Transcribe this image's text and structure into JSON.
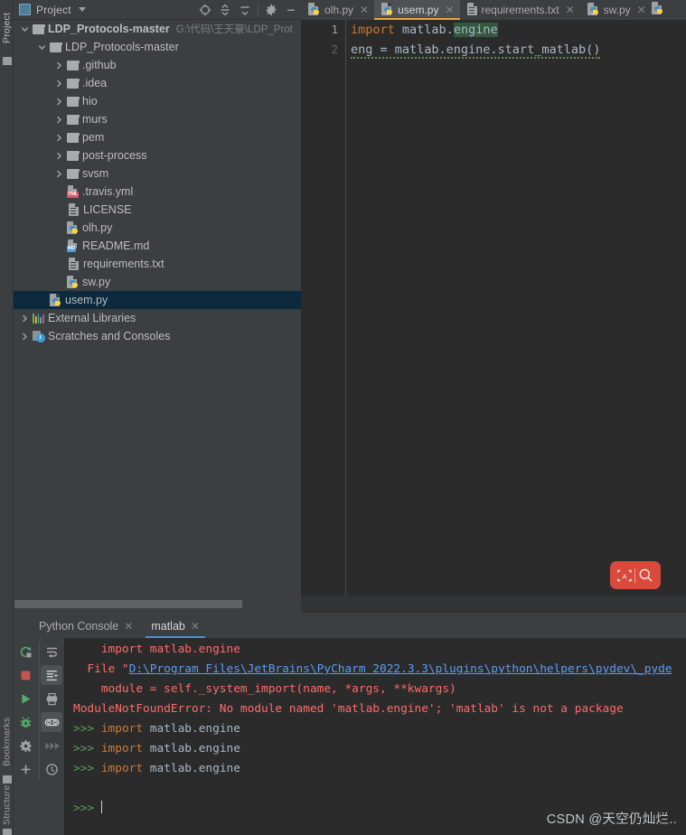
{
  "vertical_strip": {
    "labels": [
      {
        "name": "project",
        "text": "Project"
      },
      {
        "name": "bookmarks",
        "text": "Bookmarks"
      },
      {
        "name": "structure",
        "text": "Structure"
      }
    ]
  },
  "project_panel": {
    "title": "Project",
    "toolbar_icons": [
      "locate-icon",
      "expand-all-icon",
      "collapse-all-icon",
      "gear-icon",
      "minimize-icon"
    ],
    "tree": [
      {
        "name": "ldp-protocols-master-root",
        "label": "LDP_Protocols-master",
        "bold_prefix": "LDP_Protocols",
        "bold_suffix": "-master",
        "path": "G:\\代码\\王天豪\\LDP_Prot",
        "icon": "folder-icon",
        "depth": 0,
        "state": "expanded",
        "selected": false
      },
      {
        "name": "ldp-protocols-master-inner",
        "label": "LDP_Protocols-master",
        "icon": "folder-icon",
        "depth": 1,
        "state": "expanded",
        "selected": false
      },
      {
        "name": "github-folder",
        "label": ".github",
        "icon": "folder-icon",
        "depth": 2,
        "state": "collapsed",
        "selected": false
      },
      {
        "name": "idea-folder",
        "label": ".idea",
        "icon": "folder-icon",
        "depth": 2,
        "state": "collapsed",
        "selected": false
      },
      {
        "name": "hio-folder",
        "label": "hio",
        "icon": "folder-icon",
        "depth": 2,
        "state": "collapsed",
        "selected": false
      },
      {
        "name": "murs-folder",
        "label": "murs",
        "icon": "folder-icon",
        "depth": 2,
        "state": "collapsed",
        "selected": false
      },
      {
        "name": "pem-folder",
        "label": "pem",
        "icon": "folder-icon",
        "depth": 2,
        "state": "collapsed",
        "selected": false
      },
      {
        "name": "post-process-folder",
        "label": "post-process",
        "icon": "folder-icon",
        "depth": 2,
        "state": "collapsed",
        "selected": false
      },
      {
        "name": "svsm-folder",
        "label": "svsm",
        "icon": "folder-icon",
        "depth": 2,
        "state": "collapsed",
        "selected": false
      },
      {
        "name": "travis-yml-file",
        "label": ".travis.yml",
        "icon": "yaml-file-icon",
        "badge": "YML",
        "depth": 2,
        "state": "leaf",
        "selected": false
      },
      {
        "name": "license-file",
        "label": "LICENSE",
        "icon": "text-file-icon",
        "depth": 2,
        "state": "leaf",
        "selected": false
      },
      {
        "name": "olh-py-file",
        "label": "olh.py",
        "icon": "python-file-icon",
        "depth": 2,
        "state": "leaf",
        "selected": false
      },
      {
        "name": "readme-md-file",
        "label": "README.md",
        "icon": "markdown-file-icon",
        "badge": "MD",
        "depth": 2,
        "state": "leaf",
        "selected": false
      },
      {
        "name": "requirements-txt-file",
        "label": "requirements.txt",
        "icon": "text-file-icon",
        "depth": 2,
        "state": "leaf",
        "selected": false
      },
      {
        "name": "sw-py-file",
        "label": "sw.py",
        "icon": "python-file-icon",
        "depth": 2,
        "state": "leaf",
        "selected": false
      },
      {
        "name": "usem-py-file",
        "label": "usem.py",
        "icon": "python-file-icon",
        "depth": 1,
        "state": "leaf",
        "selected": true
      },
      {
        "name": "external-libraries",
        "label": "External Libraries",
        "icon": "libraries-icon",
        "depth": 0,
        "state": "collapsed",
        "selected": false
      },
      {
        "name": "scratches-and-consoles",
        "label": "Scratches and Consoles",
        "icon": "scratches-icon",
        "depth": 0,
        "state": "collapsed",
        "selected": false
      }
    ]
  },
  "editor": {
    "tabs": [
      {
        "name": "tab-olh-py",
        "label": "olh.py",
        "icon": "python-file-icon",
        "active": false
      },
      {
        "name": "tab-usem-py",
        "label": "usem.py",
        "icon": "python-file-icon",
        "active": true
      },
      {
        "name": "tab-requirements-txt",
        "label": "requirements.txt",
        "icon": "text-file-icon",
        "active": false
      },
      {
        "name": "tab-sw-py",
        "label": "sw.py",
        "icon": "python-file-icon",
        "active": false
      }
    ],
    "close_glyph": "✕",
    "line_numbers": [
      "1",
      "2"
    ],
    "code_lines": [
      {
        "number": "1",
        "keyword": "import",
        "plain": " matlab.",
        "highlight": "engine"
      },
      {
        "number": "2",
        "plain_full": "eng = matlab.engine.start_matlab()"
      }
    ],
    "ai_widget": {
      "name": "ai-search-widget",
      "ai_label": "A",
      "color": "#d94a3d"
    }
  },
  "console": {
    "tabs": [
      {
        "name": "console-tab-python-console",
        "label": "Python Console",
        "active": false
      },
      {
        "name": "console-tab-matlab",
        "label": "matlab",
        "active": true
      }
    ],
    "close_glyph": "✕",
    "toolbar_left": [
      "rerun-icon",
      "stop-icon",
      "run-icon",
      "debug-icon",
      "settings-icon",
      "add-icon"
    ],
    "toolbar_right": [
      "soft-wrap-icon",
      "scroll-to-end-icon",
      "print-icon",
      "use-soft-wraps-icon",
      "fast-forward-icon",
      "history-icon"
    ],
    "output": [
      {
        "kind": "err",
        "text": "    import matlab.engine"
      },
      {
        "kind": "err_link",
        "prefix": "  File \"",
        "link": "D:\\Program Files\\JetBrains\\PyCharm 2022.3.3\\plugins\\python\\helpers\\pydev\\_pyde"
      },
      {
        "kind": "err",
        "text": "    module = self._system_import(name, *args, **kwargs)"
      },
      {
        "kind": "err",
        "text": "ModuleNotFoundError: No module named 'matlab.engine'; 'matlab' is not a package"
      },
      {
        "kind": "prompt",
        "prompt": ">>>",
        "keyword": "import",
        "rest": " matlab.engine"
      },
      {
        "kind": "prompt",
        "prompt": ">>>",
        "keyword": "import",
        "rest": " matlab.engine"
      },
      {
        "kind": "prompt",
        "prompt": ">>>",
        "keyword": "import",
        "rest": " matlab.engine"
      },
      {
        "kind": "blank",
        "text": ""
      },
      {
        "kind": "prompt_empty",
        "prompt": ">>>"
      }
    ]
  },
  "watermark": {
    "text": "CSDN @天空仍灿烂.."
  }
}
